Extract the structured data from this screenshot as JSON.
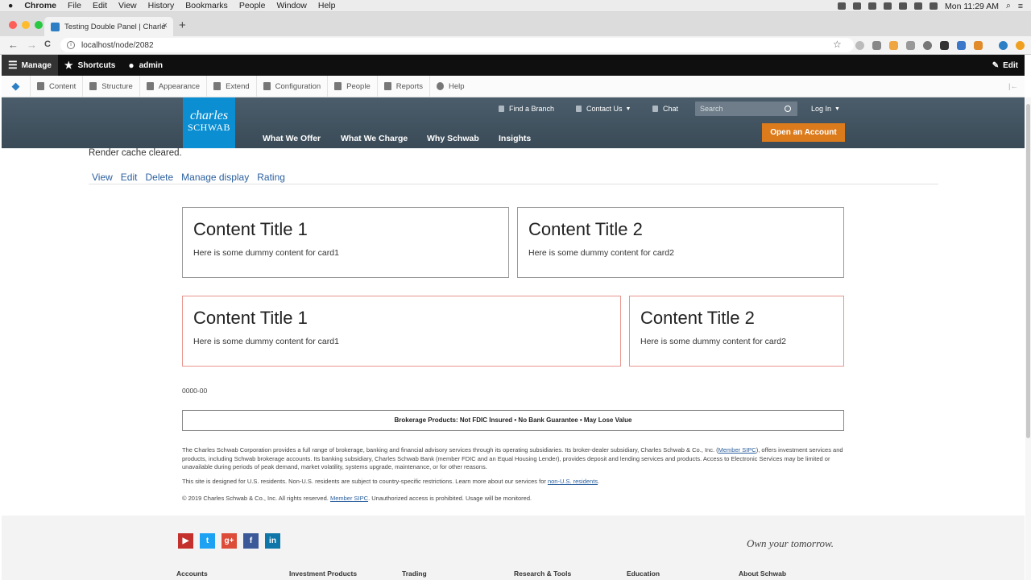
{
  "mac_menubar": {
    "apple": "",
    "app": "Chrome",
    "menus": [
      "File",
      "Edit",
      "View",
      "History",
      "Bookmarks",
      "People",
      "Window",
      "Help"
    ],
    "clock": "Mon 11:29 AM"
  },
  "browser": {
    "tab_title": "Testing Double Panel | Charles",
    "tab_close": "×",
    "new_tab": "+",
    "url": "localhost/node/2082",
    "back": "←",
    "forward": "→",
    "reload": "C",
    "star": "☆"
  },
  "admin_toolbar": {
    "manage": "Manage",
    "shortcuts": "Shortcuts",
    "user": "admin",
    "edit": "Edit",
    "tray": [
      "Content",
      "Structure",
      "Appearance",
      "Extend",
      "Configuration",
      "People",
      "Reports",
      "Help"
    ]
  },
  "schwab_header": {
    "logo_line1": "charles",
    "logo_line2": "SCHWAB",
    "find_branch": "Find a Branch",
    "contact_us": "Contact Us",
    "chat": "Chat",
    "search_placeholder": "Search",
    "login": "Log In",
    "nav": [
      "What We Offer",
      "What We Charge",
      "Why Schwab",
      "Insights"
    ],
    "cta": "Open an Account"
  },
  "status_message": "Render cache cleared.",
  "local_tasks": [
    "View",
    "Edit",
    "Delete",
    "Manage display",
    "Rating"
  ],
  "cards_row1": [
    {
      "title": "Content Title 1",
      "body": "Here is some dummy content for card1"
    },
    {
      "title": "Content Title 2",
      "body": "Here is some dummy content for card2"
    }
  ],
  "cards_row2": [
    {
      "title": "Content Title 1",
      "body": "Here is some dummy content for card1"
    },
    {
      "title": "Content Title 2",
      "body": "Here is some dummy content for card2"
    }
  ],
  "code": "0000-00",
  "disclaimer": "Brokerage Products: Not FDIC Insured • No Bank Guarantee • May Lose Value",
  "legal": {
    "p1_a": "The Charles Schwab Corporation provides a full range of brokerage, banking and financial advisory services through its operating subsidiaries. Its broker-dealer subsidiary, Charles Schwab & Co., Inc. (",
    "p1_link": "Member SIPC",
    "p1_b": "), offers investment services and products, including Schwab brokerage accounts. Its banking subsidiary, Charles Schwab Bank (member FDIC and an Equal Housing Lender), provides deposit and lending services and products. Access to Electronic Services may be limited or unavailable during periods of peak demand, market volatility, systems upgrade, maintenance, or for other reasons.",
    "p2_a": "This site is designed for U.S. residents. Non-U.S. residents are subject to country-specific restrictions. Learn more about our services for ",
    "p2_link": "non-U.S. residents",
    "p2_b": ".",
    "p3_a": "© 2019 Charles Schwab & Co., Inc. All rights reserved. ",
    "p3_link": "Member SIPC",
    "p3_b": ". Unauthorized access is prohibited. Usage will be monitored."
  },
  "footer": {
    "social": [
      {
        "name": "youtube",
        "glyph": "▶",
        "color": "#c4302b"
      },
      {
        "name": "twitter",
        "glyph": "t",
        "color": "#1da1f2"
      },
      {
        "name": "google-plus",
        "glyph": "g+",
        "color": "#dd4b39"
      },
      {
        "name": "facebook",
        "glyph": "f",
        "color": "#3b5998"
      },
      {
        "name": "linkedin",
        "glyph": "in",
        "color": "#0e76a8"
      }
    ],
    "tagline": "Own your tomorrow.",
    "columns": [
      "Accounts",
      "Investment Products",
      "Trading",
      "Research & Tools",
      "Education",
      "About Schwab"
    ]
  }
}
